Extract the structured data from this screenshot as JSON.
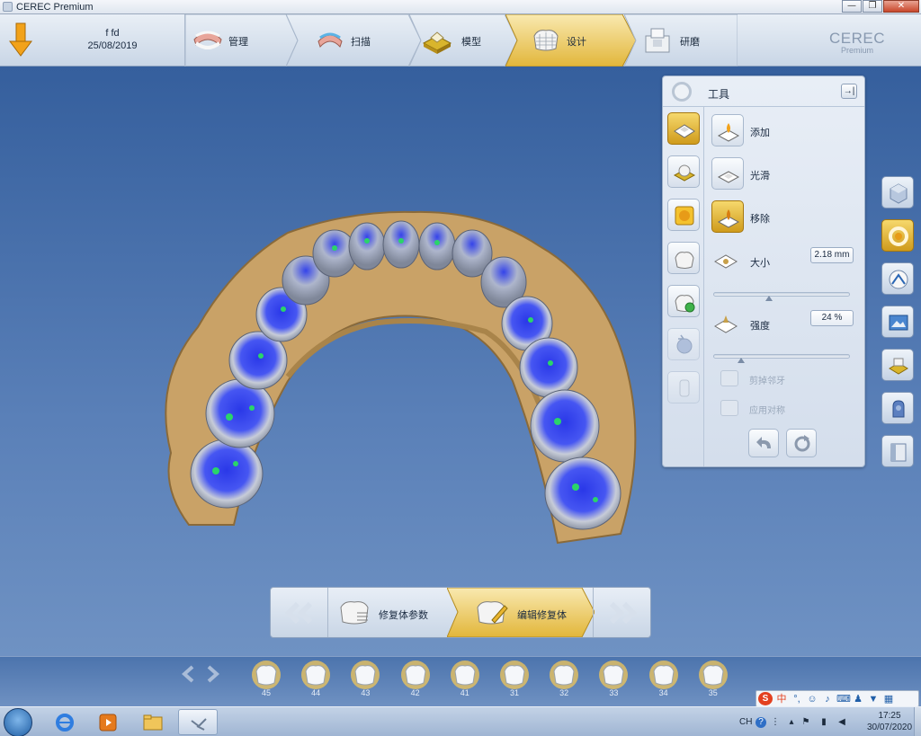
{
  "window": {
    "title": "CEREC Premium",
    "controls": [
      "—",
      "❐",
      "✕"
    ]
  },
  "patient": {
    "name": "f fd",
    "date": "25/08/2019"
  },
  "workflow": {
    "steps": [
      {
        "label": "管理",
        "icon": "jaw-model-icon",
        "active": false
      },
      {
        "label": "扫描",
        "icon": "scan-icon",
        "active": false
      },
      {
        "label": "模型",
        "icon": "model-icon",
        "active": false
      },
      {
        "label": "设计",
        "icon": "crown-design-icon",
        "active": true
      },
      {
        "label": "研磨",
        "icon": "milling-machine-icon",
        "active": false
      }
    ]
  },
  "brand": {
    "name": "CEREC",
    "edition": "Premium"
  },
  "tools": {
    "title": "工具",
    "pin_symbol": "→|",
    "options": [
      {
        "label": "添加",
        "active": false
      },
      {
        "label": "光滑",
        "active": false
      },
      {
        "label": "移除",
        "active": true
      }
    ],
    "size": {
      "label": "大小",
      "value": "2.18 mm",
      "slider_fraction": 0.4
    },
    "strength": {
      "label": "强度",
      "value": "24 %",
      "slider_fraction": 0.2
    },
    "checkboxes": [
      {
        "label": "剪掉邻牙",
        "enabled": false
      },
      {
        "label": "应用对称",
        "enabled": false
      }
    ]
  },
  "phase_nav": {
    "steps": [
      {
        "label": "修复体参数",
        "active": false
      },
      {
        "label": "编辑修复体",
        "active": true
      }
    ]
  },
  "teeth": [
    {
      "number": "45"
    },
    {
      "number": "44"
    },
    {
      "number": "43"
    },
    {
      "number": "42"
    },
    {
      "number": "41"
    },
    {
      "number": "31"
    },
    {
      "number": "32"
    },
    {
      "number": "33"
    },
    {
      "number": "34"
    },
    {
      "number": "35"
    }
  ],
  "ime": {
    "logo": "S",
    "mode": "中",
    "punct": "°,"
  },
  "taskbar": {
    "lang": "CH",
    "time": "17:25",
    "date": "30/07/2020"
  },
  "colors": {
    "accent": "#f0c33c",
    "background": "#3f6aa6"
  }
}
